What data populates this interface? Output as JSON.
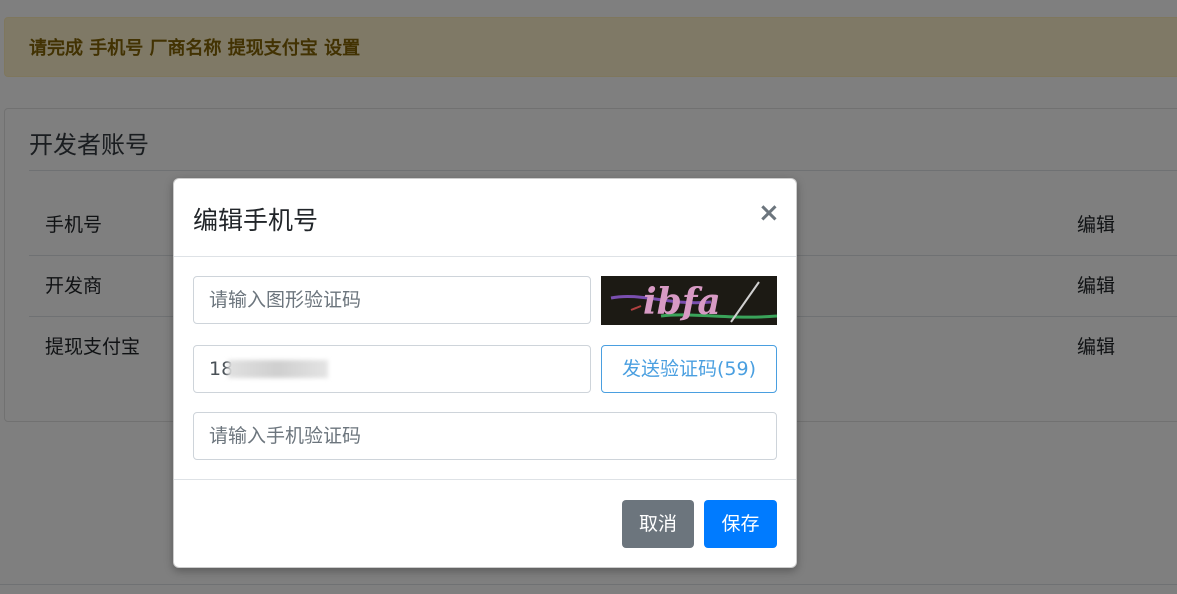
{
  "alert": {
    "text": "请完成 手机号 厂商名称 提现支付宝 设置"
  },
  "card": {
    "title": "开发者账号",
    "rows": [
      {
        "label": "手机号",
        "action": "编辑"
      },
      {
        "label": "开发商",
        "action": "编辑"
      },
      {
        "label": "提现支付宝",
        "action": "编辑"
      }
    ]
  },
  "modal": {
    "title": "编辑手机号",
    "close_glyph": "×",
    "captcha_placeholder": "请输入图形验证码",
    "captcha_text": "ibfa",
    "phone_value": "18",
    "send_code_label": "发送验证码(59)",
    "sms_placeholder": "请输入手机验证码",
    "cancel_label": "取消",
    "save_label": "保存"
  },
  "colors": {
    "alert_bg": "#fff3cd",
    "alert_text": "#856404",
    "primary": "#007bff",
    "secondary": "#6c757d",
    "send_outline": "#4a9fe0"
  }
}
